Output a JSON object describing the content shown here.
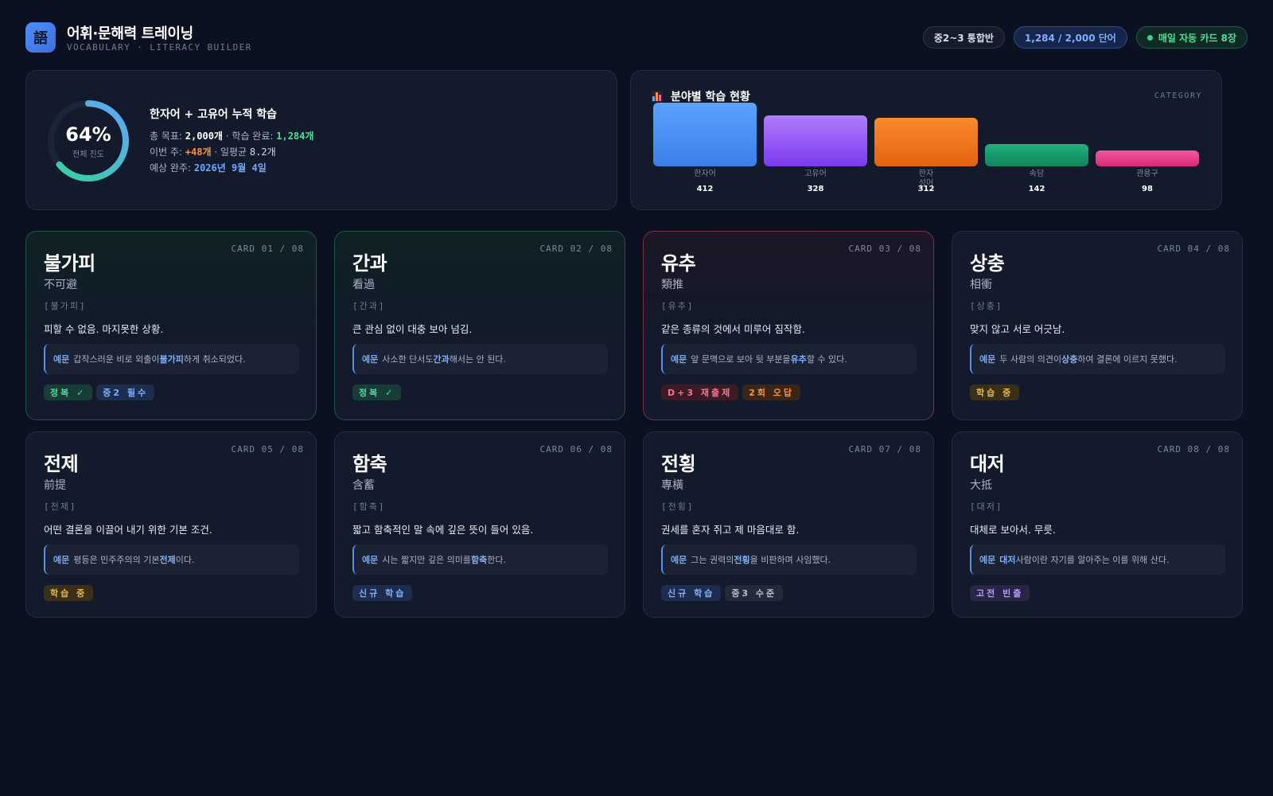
{
  "header": {
    "logo_glyph": "語",
    "title": "어휘·문해력 트레이닝",
    "subtitle": "VOCABULARY · LITERACY BUILDER",
    "class_pill": "중2~3 통합반",
    "words_pill": "1,284 / 2,000 단어",
    "daily_pill": "매일 자동 카드 8장"
  },
  "progress": {
    "percent_value": 64,
    "percent_text": "64%",
    "ring_label": "전체 진도",
    "title": "한자어 + 고유어 누적 학습",
    "goal_label": "총 목표: ",
    "goal_value": "2,000개",
    "done_label": " · 학습 완료: ",
    "done_value": "1,284개",
    "week_label": "이번 주: ",
    "week_value": "+48개",
    "avg_label": " · 일평균 ",
    "avg_value": "8.2개",
    "eta_label": "예상 완주: ",
    "eta_value": "2026년 9월 4일"
  },
  "category": {
    "title": "분야별 학습 현황",
    "tag": "CATEGORY",
    "icon": "bar-chart-icon"
  },
  "chart_data": {
    "type": "bar",
    "categories": [
      "한자어",
      "고유어",
      "한자\n성어",
      "속담",
      "관용구"
    ],
    "values": [
      412,
      328,
      312,
      142,
      98
    ],
    "colors": [
      [
        "#5aa2ff",
        "#3b7fe8"
      ],
      [
        "#b07cff",
        "#7c3aed"
      ],
      [
        "#fb8a2e",
        "#e5620f"
      ],
      [
        "#22b07d",
        "#10855b"
      ],
      [
        "#f05a9c",
        "#db2777"
      ]
    ],
    "title": "분야별 학습 현황",
    "grid": false
  },
  "cards": [
    {
      "no": "CARD 01 / 08",
      "word": "불가피",
      "hanja": "不可避",
      "reading": "[불가피]",
      "meaning": "피할 수 없음. 마지못한 상황.",
      "ex_tag": "예문",
      "ex_pre": "갑작스러운 비로 외출이 ",
      "ex_hl": "불가피",
      "ex_post": "하게 취소되었다.",
      "tags": [
        {
          "label": "정복 ✓",
          "style": "green"
        },
        {
          "label": "중2 필수",
          "style": "blue"
        }
      ],
      "state": "mastered"
    },
    {
      "no": "CARD 02 / 08",
      "word": "간과",
      "hanja": "看過",
      "reading": "[간과]",
      "meaning": "큰 관심 없이 대충 보아 넘김.",
      "ex_tag": "예문",
      "ex_pre": "사소한 단서도 ",
      "ex_hl": "간과",
      "ex_post": "해서는 안 된다.",
      "tags": [
        {
          "label": "정복 ✓",
          "style": "green"
        }
      ],
      "state": "mastered"
    },
    {
      "no": "CARD 03 / 08",
      "word": "유추",
      "hanja": "類推",
      "reading": "[유추]",
      "meaning": "같은 종류의 것에서 미루어 짐작함.",
      "ex_tag": "예문",
      "ex_pre": "앞 문맥으로 보아 뒷 부분을 ",
      "ex_hl": "유추",
      "ex_post": "할 수 있다.",
      "tags": [
        {
          "label": "D+3 재출제",
          "style": "red"
        },
        {
          "label": "2회 오답",
          "style": "orange"
        }
      ],
      "state": "wrong"
    },
    {
      "no": "CARD 04 / 08",
      "word": "상충",
      "hanja": "相衝",
      "reading": "[상충]",
      "meaning": "맞지 않고 서로 어긋남.",
      "ex_tag": "예문",
      "ex_pre": "두 사람의 의견이 ",
      "ex_hl": "상충",
      "ex_post": "하여 결론에 이르지 못했다.",
      "tags": [
        {
          "label": "학습 중",
          "style": "yellow"
        }
      ],
      "state": "normal"
    },
    {
      "no": "CARD 05 / 08",
      "word": "전제",
      "hanja": "前提",
      "reading": "[전제]",
      "meaning": "어떤 결론을 이끌어 내기 위한 기본 조건.",
      "ex_tag": "예문",
      "ex_pre": "평등은 민주주의의 기본 ",
      "ex_hl": "전제",
      "ex_post": "이다.",
      "tags": [
        {
          "label": "학습 중",
          "style": "yellow"
        }
      ],
      "state": "normal"
    },
    {
      "no": "CARD 06 / 08",
      "word": "함축",
      "hanja": "含蓄",
      "reading": "[함축]",
      "meaning": "짧고 함축적인 말 속에 깊은 뜻이 들어 있음.",
      "ex_tag": "예문",
      "ex_pre": "시는 짧지만 깊은 의미를 ",
      "ex_hl": "함축",
      "ex_post": "한다.",
      "tags": [
        {
          "label": "신규 학습",
          "style": "blue"
        }
      ],
      "state": "normal"
    },
    {
      "no": "CARD 07 / 08",
      "word": "전횡",
      "hanja": "專橫",
      "reading": "[전횡]",
      "meaning": "권세를 혼자 쥐고 제 마음대로 함.",
      "ex_tag": "예문",
      "ex_pre": "그는 권력의 ",
      "ex_hl": "전횡",
      "ex_post": "을 비판하며 사임했다.",
      "tags": [
        {
          "label": "신규 학습",
          "style": "blue"
        },
        {
          "label": "중3 수준",
          "style": "gray"
        }
      ],
      "state": "normal"
    },
    {
      "no": "CARD 08 / 08",
      "word": "대저",
      "hanja": "大抵",
      "reading": "[대저]",
      "meaning": "대체로 보아서. 무릇.",
      "ex_tag": "예문",
      "ex_pre": "",
      "ex_hl": "대저",
      "ex_post": " 사람이란 자기를 알아주는 이를 위해 산다.",
      "tags": [
        {
          "label": "고전 빈출",
          "style": "purple"
        }
      ],
      "state": "normal"
    }
  ]
}
